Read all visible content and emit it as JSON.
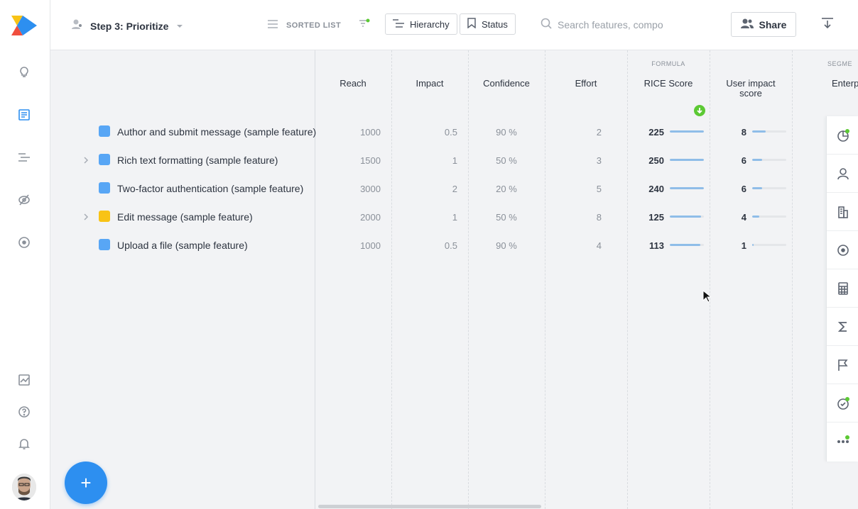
{
  "colors": {
    "accent": "#2d8ff0",
    "blue_swatch": "#58a6f5",
    "yellow_swatch": "#f8c316",
    "bar": "#8fbde8",
    "green": "#5cc934"
  },
  "sidebar": {
    "icons": [
      "lightbulb-icon",
      "document-icon",
      "roadmap-icon",
      "hidden-eye-icon",
      "target-icon",
      "analytics-icon",
      "help-icon",
      "bell-icon"
    ]
  },
  "topbar": {
    "step_label": "Step 3: Prioritize",
    "view_label": "SORTED LIST",
    "hierarchy_label": "Hierarchy",
    "status_label": "Status",
    "search_placeholder": "Search features, compo",
    "share_label": "Share"
  },
  "table": {
    "group_formula": "FORMULA",
    "group_segments": "SEGME",
    "columns": {
      "reach": "Reach",
      "impact": "Impact",
      "confidence": "Confidence",
      "effort": "Effort",
      "rice": "RICE Score",
      "user_impact": "User impact score",
      "enterprise": "Enterp"
    },
    "rows": [
      {
        "name": "Author and submit message (sample feature)",
        "expandable": false,
        "color": "#58a6f5",
        "reach": "1000",
        "impact": "0.5",
        "confidence": "90 %",
        "effort": "2",
        "rice": "225",
        "rice_fraction": 1.0,
        "user_impact": "8",
        "ui_fraction": 0.4
      },
      {
        "name": "Rich text formatting (sample feature)",
        "expandable": true,
        "color": "#58a6f5",
        "reach": "1500",
        "impact": "1",
        "confidence": "50 %",
        "effort": "3",
        "rice": "250",
        "rice_fraction": 1.0,
        "user_impact": "6",
        "ui_fraction": 0.3
      },
      {
        "name": "Two-factor authentication (sample feature)",
        "expandable": false,
        "color": "#58a6f5",
        "reach": "3000",
        "impact": "2",
        "confidence": "20 %",
        "effort": "5",
        "rice": "240",
        "rice_fraction": 1.0,
        "user_impact": "6",
        "ui_fraction": 0.3
      },
      {
        "name": "Edit message (sample feature)",
        "expandable": true,
        "color": "#f8c316",
        "reach": "2000",
        "impact": "1",
        "confidence": "50 %",
        "effort": "8",
        "rice": "125",
        "rice_fraction": 0.92,
        "user_impact": "4",
        "ui_fraction": 0.2
      },
      {
        "name": "Upload a file (sample feature)",
        "expandable": false,
        "color": "#58a6f5",
        "reach": "1000",
        "impact": "0.5",
        "confidence": "90 %",
        "effort": "4",
        "rice": "113",
        "rice_fraction": 0.9,
        "user_impact": "1",
        "ui_fraction": 0.05
      }
    ]
  },
  "right_panel": {
    "icons": [
      "pie-chart-icon",
      "user-icon",
      "building-icon",
      "target-icon",
      "calculator-icon",
      "sigma-icon",
      "flag-icon",
      "check-circle-icon",
      "more-icon"
    ]
  },
  "fab_label": "+"
}
